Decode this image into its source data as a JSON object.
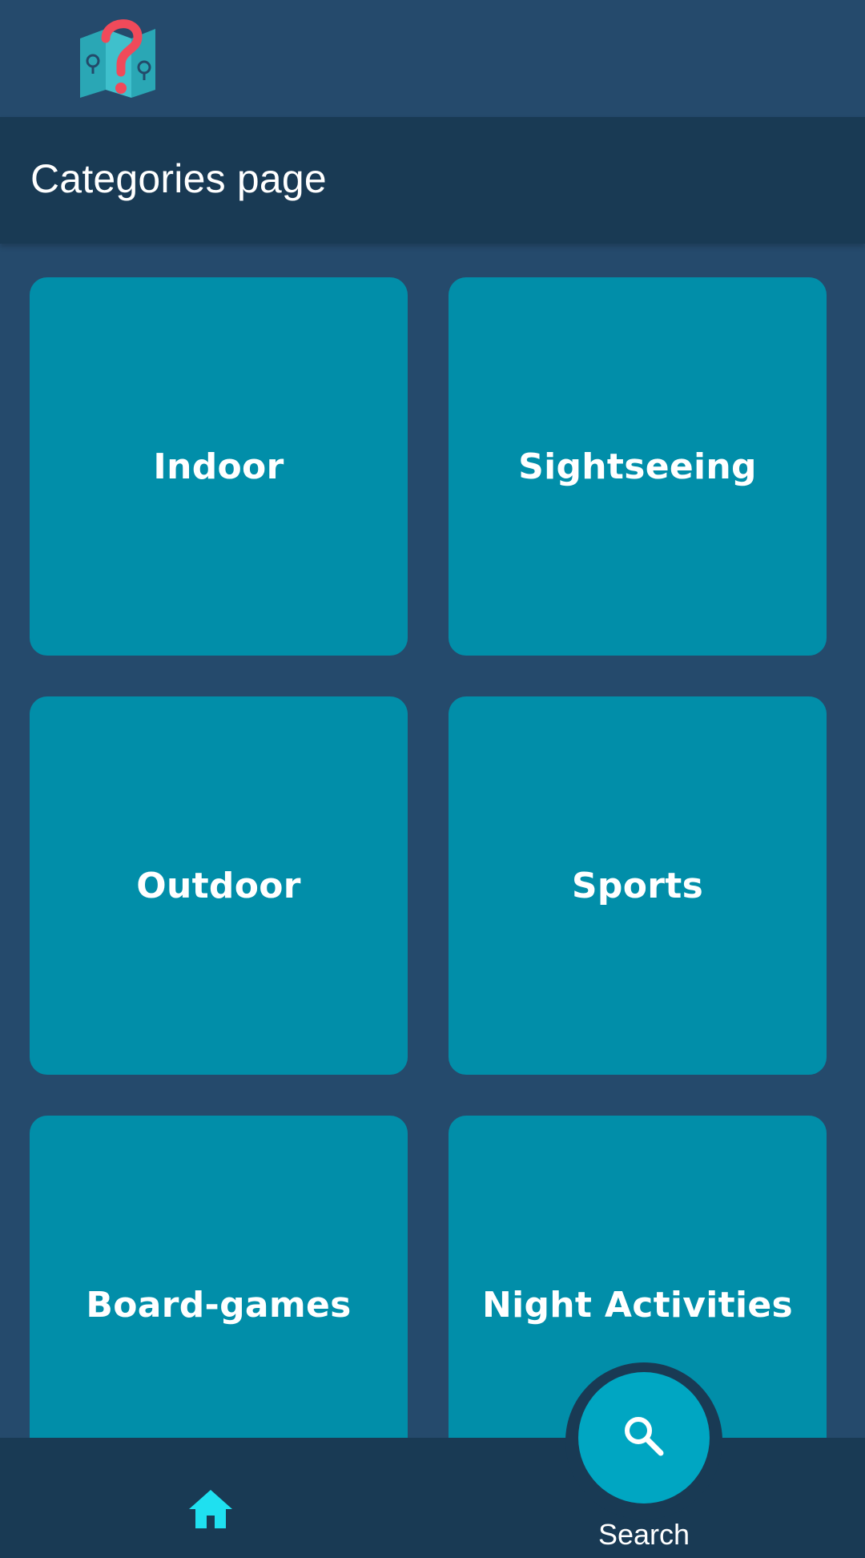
{
  "header": {
    "logo_icon": "map-question-logo-icon"
  },
  "page": {
    "title": "Categories page"
  },
  "categories": [
    {
      "label": "Indoor"
    },
    {
      "label": "Sightseeing"
    },
    {
      "label": "Outdoor"
    },
    {
      "label": "Sports"
    },
    {
      "label": "Board-games"
    },
    {
      "label": "Night Activities"
    }
  ],
  "bottom_nav": {
    "home_icon": "home-icon",
    "search_icon": "search-icon",
    "search_label": "Search"
  },
  "colors": {
    "background": "#254a6c",
    "bar": "#193a54",
    "card": "#018ea9",
    "fab": "#00a6c2",
    "home_icon": "#1fe0f0",
    "logo_map": "#2aa7b5",
    "logo_question": "#f04a5a"
  }
}
